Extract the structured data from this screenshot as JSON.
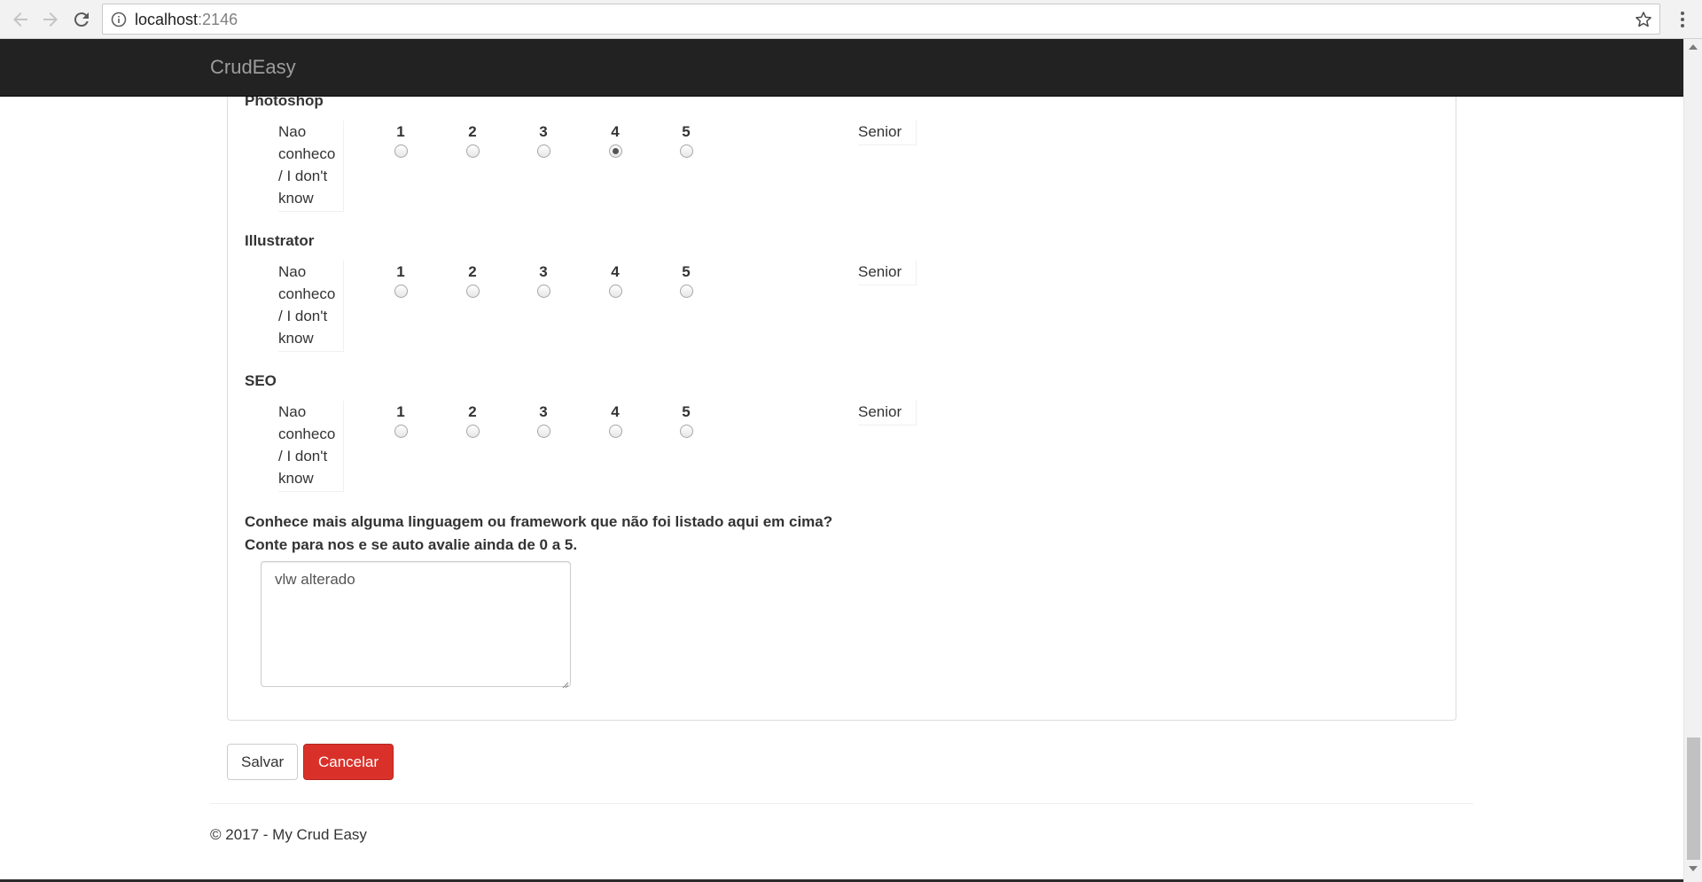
{
  "browser": {
    "url_host": "localhost",
    "url_port": ":2146"
  },
  "navbar": {
    "brand": "CrudEasy"
  },
  "levels": [
    "1",
    "2",
    "3",
    "4",
    "5"
  ],
  "skills": [
    {
      "name": "Photoshop",
      "na_label": "Nao conheco / I don't know",
      "senior_label": "Senior",
      "selected": 4
    },
    {
      "name": "Illustrator",
      "na_label": "Nao conheco / I don't know",
      "senior_label": "Senior",
      "selected": null
    },
    {
      "name": "SEO",
      "na_label": "Nao conheco / I don't know",
      "senior_label": "Senior",
      "selected": null
    }
  ],
  "question": {
    "line1": "Conhece mais alguma linguagem ou framework que não foi listado aqui em cima?",
    "line2": "Conte para nos e se auto avalie ainda de 0 a 5.",
    "answer": "vlw alterado"
  },
  "actions": {
    "save_label": "Salvar",
    "cancel_label": "Cancelar"
  },
  "footer": {
    "text": "© 2017 - My Crud Easy"
  },
  "colors": {
    "navbar_bg": "#222222",
    "brand_text": "#9d9d9d",
    "cancel_bg": "#d9312a"
  },
  "icons": {
    "back": "arrow-left-icon",
    "forward": "arrow-right-icon",
    "reload": "reload-icon",
    "info": "info-icon",
    "bookmark": "star-icon",
    "menu": "kebab-menu-icon"
  }
}
